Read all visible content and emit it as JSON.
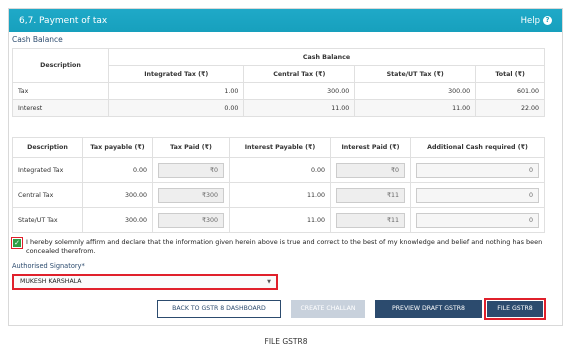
{
  "header": {
    "title": "6,7. Payment of tax",
    "help_label": "Help",
    "help_icon": "?"
  },
  "cash_balance": {
    "section_title": "Cash Balance",
    "columns": {
      "description": "Description",
      "group": "Cash Balance",
      "integrated": "Integrated Tax (₹)",
      "central": "Central Tax (₹)",
      "state": "State/UT Tax (₹)",
      "total": "Total (₹)"
    },
    "rows": [
      {
        "label": "Tax",
        "integrated": "1.00",
        "central": "300.00",
        "state": "300.00",
        "total": "601.00"
      },
      {
        "label": "Interest",
        "integrated": "0.00",
        "central": "11.00",
        "state": "11.00",
        "total": "22.00"
      }
    ]
  },
  "payment": {
    "columns": {
      "description": "Description",
      "tax_payable": "Tax payable (₹)",
      "tax_paid": "Tax Paid (₹)",
      "interest_payable": "Interest Payable (₹)",
      "interest_paid": "Interest Paid (₹)",
      "additional_cash": "Additional Cash required (₹)"
    },
    "rows": [
      {
        "label": "Integrated Tax",
        "tax_payable": "0.00",
        "tax_paid": "₹0",
        "interest_payable": "0.00",
        "interest_paid": "₹0",
        "additional_cash": "0"
      },
      {
        "label": "Central Tax",
        "tax_payable": "300.00",
        "tax_paid": "₹300",
        "interest_payable": "11.00",
        "interest_paid": "₹11",
        "additional_cash": "0"
      },
      {
        "label": "State/UT Tax",
        "tax_payable": "300.00",
        "tax_paid": "₹300",
        "interest_payable": "11.00",
        "interest_paid": "₹11",
        "additional_cash": "0"
      }
    ]
  },
  "declaration": {
    "checked": true,
    "text": "I hereby solemnly affirm and declare that the information given herein above is true and correct to the best of my knowledge and belief and nothing has been concealed therefrom."
  },
  "signatory": {
    "label": "Authorised Signatory*",
    "selected": "MUKESH KARSHALA"
  },
  "buttons": {
    "back": "BACK TO GSTR 8 DASHBOARD",
    "create_challan": "CREATE CHALLAN",
    "preview": "PREVIEW DRAFT GSTR8",
    "file": "FILE GSTR8"
  },
  "caption": "FILE GSTR8",
  "colors": {
    "header": "#1aa3c0",
    "primary": "#2c4b6e",
    "highlight": "#e0202b",
    "check": "#2e9e44"
  }
}
